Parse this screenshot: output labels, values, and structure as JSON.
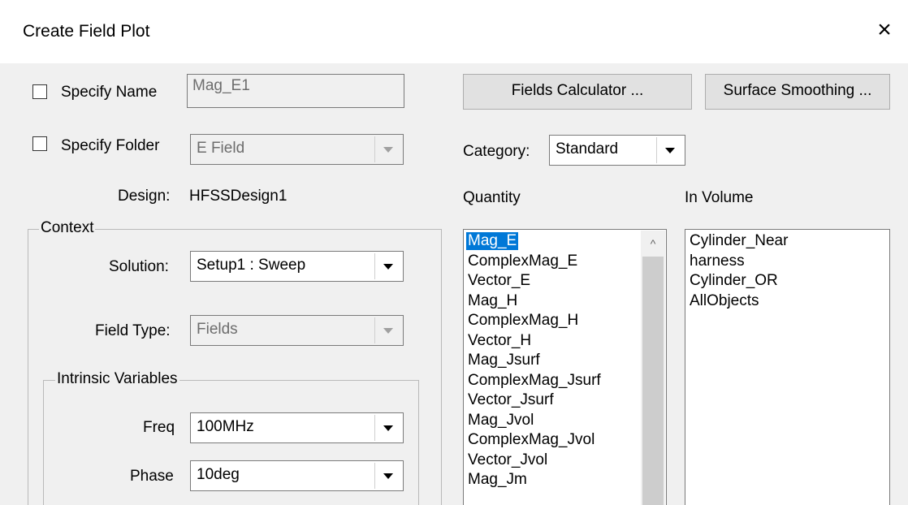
{
  "dialog": {
    "title": "Create Field Plot",
    "close": "×"
  },
  "specify_name": {
    "label": "Specify Name",
    "value": "Mag_E1"
  },
  "specify_folder": {
    "label": "Specify Folder",
    "value": "E Field"
  },
  "design": {
    "label": "Design:",
    "value": "HFSSDesign1"
  },
  "buttons": {
    "fields_calculator": "Fields Calculator ...",
    "surface_smoothing": "Surface Smoothing ..."
  },
  "category": {
    "label": "Category:",
    "value": "Standard"
  },
  "quantity": {
    "label": "Quantity",
    "items": [
      "Mag_E",
      "ComplexMag_E",
      "Vector_E",
      "Mag_H",
      "ComplexMag_H",
      "Vector_H",
      "Mag_Jsurf",
      "ComplexMag_Jsurf",
      "Vector_Jsurf",
      "Mag_Jvol",
      "ComplexMag_Jvol",
      "Vector_Jvol",
      "Mag_Jm"
    ],
    "selected": "Mag_E",
    "scroll_up": "^"
  },
  "in_volume": {
    "label": "In Volume",
    "items": [
      "Cylinder_Near",
      "harness",
      "Cylinder_OR",
      "AllObjects"
    ]
  },
  "context": {
    "legend": "Context",
    "solution": {
      "label": "Solution:",
      "value": "Setup1 : Sweep"
    },
    "field_type": {
      "label": "Field Type:",
      "value": "Fields"
    }
  },
  "intrinsic": {
    "legend": "Intrinsic Variables",
    "freq": {
      "label": "Freq",
      "value": "100MHz"
    },
    "phase": {
      "label": "Phase",
      "value": "10deg"
    }
  },
  "icons": {
    "close": "close-icon",
    "dropdown": "chevron-down-icon",
    "scroll_up": "scroll-up-icon"
  }
}
